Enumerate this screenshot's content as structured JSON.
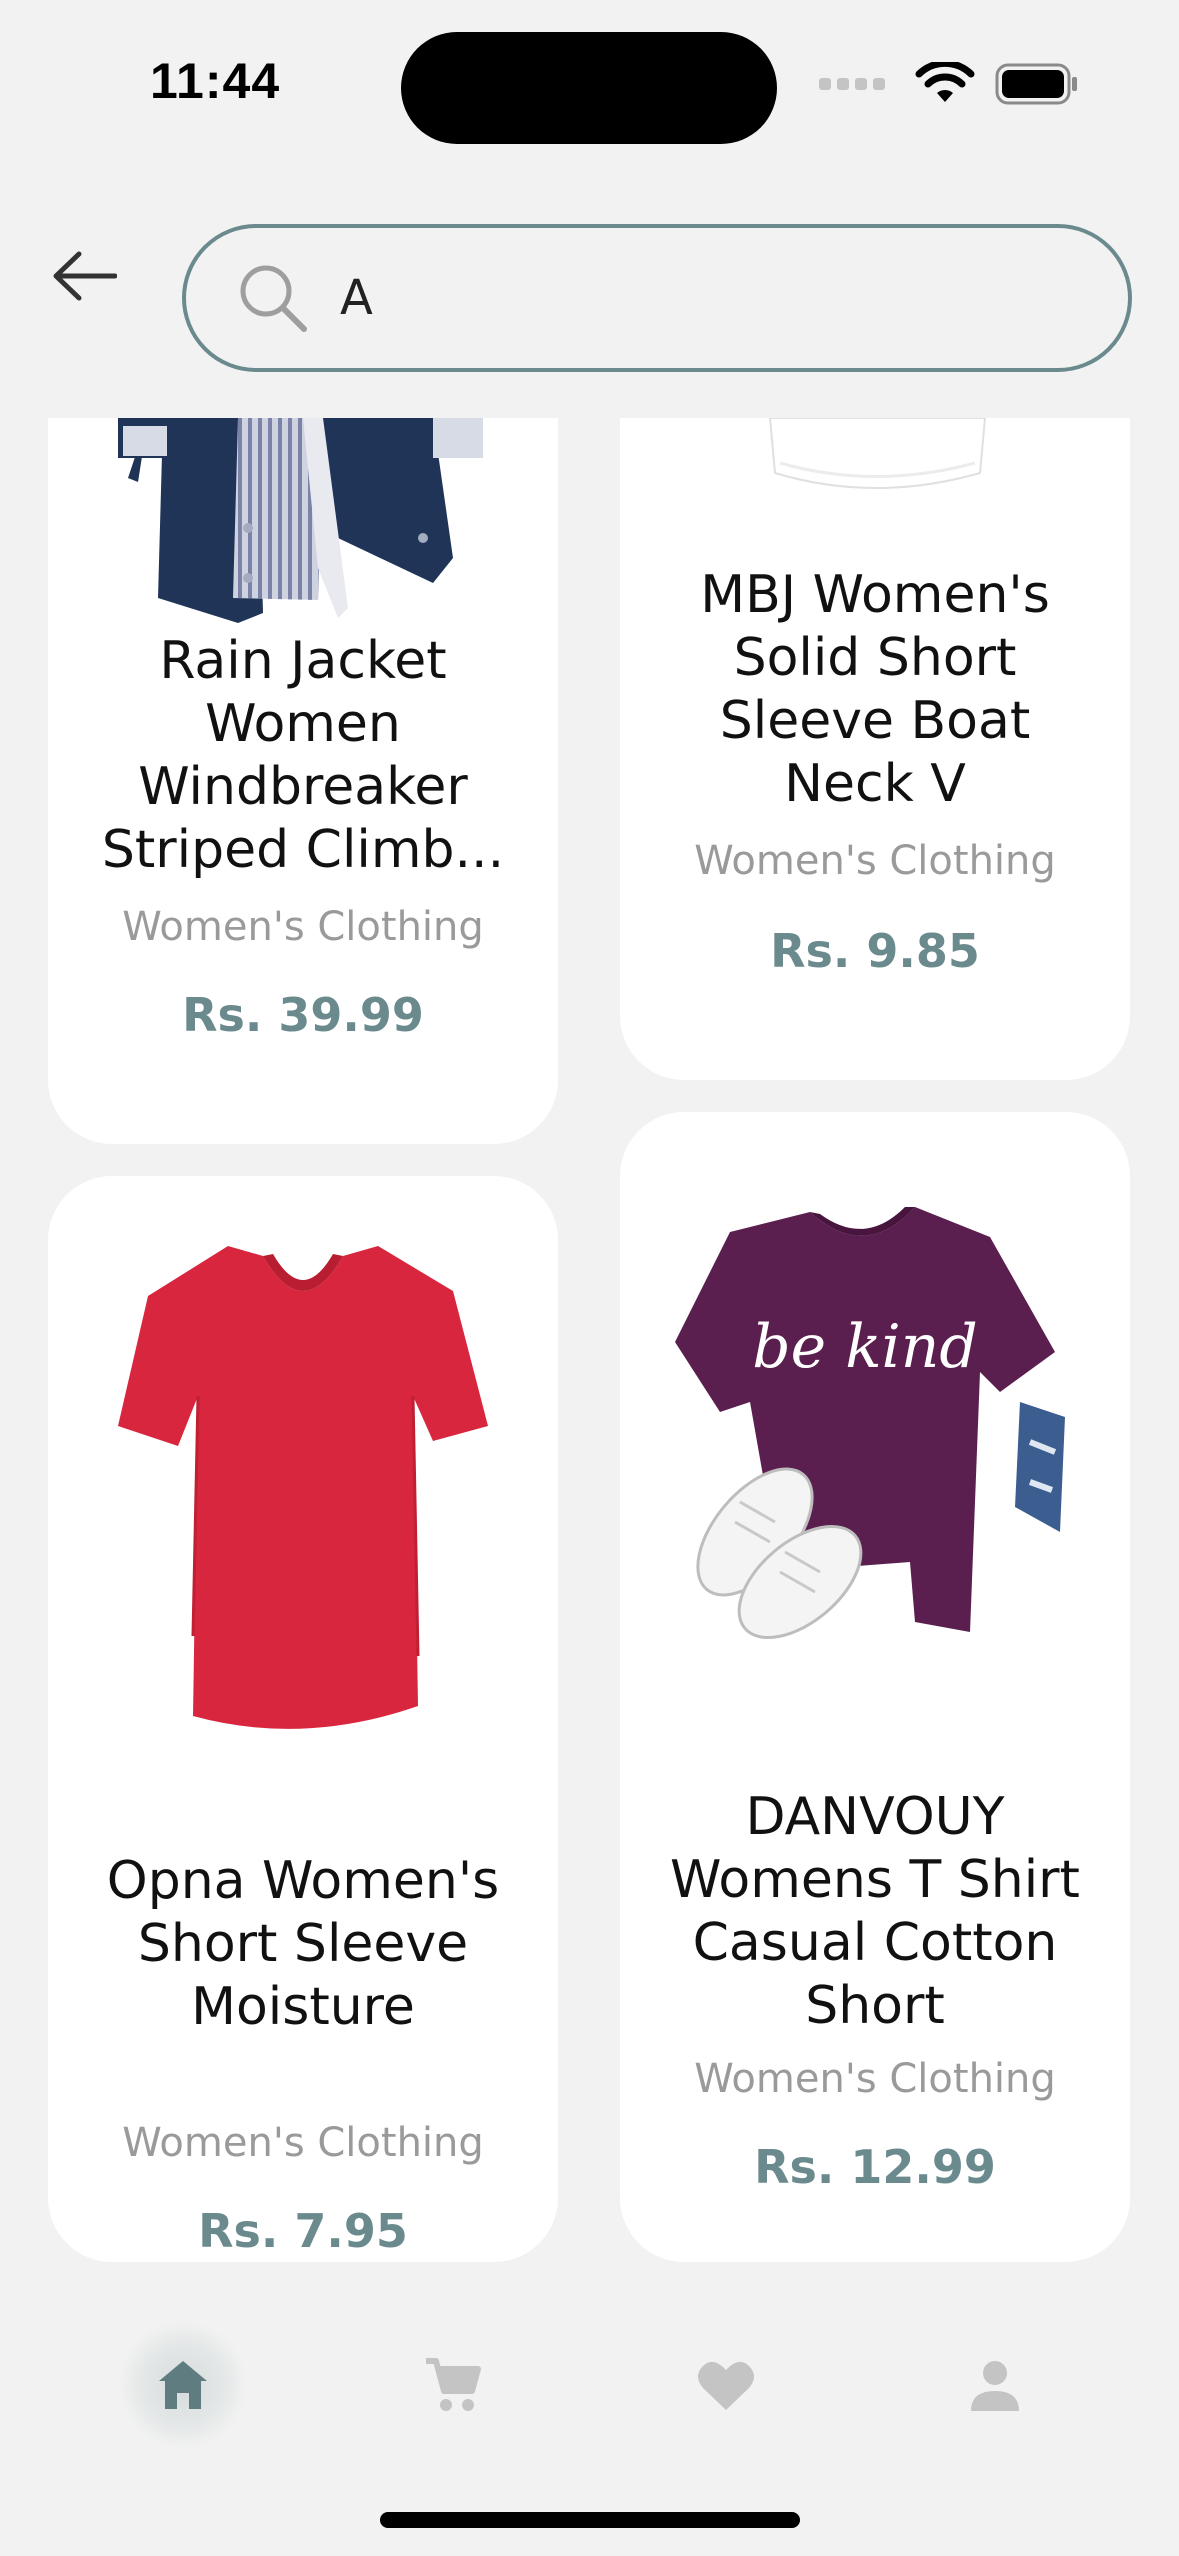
{
  "status_bar": {
    "time": "11:44"
  },
  "search": {
    "value": "A",
    "placeholder": ""
  },
  "products": [
    {
      "name": "Rain Jacket Women Windbreaker Striped Climb...",
      "category": "Women's Clothing",
      "price": "Rs. 39.99"
    },
    {
      "name": "MBJ Women's Solid Short Sleeve Boat Neck V",
      "category": "Women's Clothing",
      "price": "Rs. 9.85"
    },
    {
      "name": "Opna Women's Short Sleeve Moisture",
      "category": "Women's Clothing",
      "price": "Rs. 7.95"
    },
    {
      "name": "DANVOUY Womens T Shirt Casual Cotton Short",
      "category": "Women's Clothing",
      "price": "Rs. 12.99"
    }
  ],
  "product_art": [
    {
      "icon": "rain-jacket-image",
      "color": "#1f3457"
    },
    {
      "icon": "white-tshirt-image",
      "color": "#ffffff"
    },
    {
      "icon": "red-tshirt-image",
      "color": "#d7263d"
    },
    {
      "icon": "purple-tshirt-image",
      "color": "#5a1e4f",
      "print_text": "be kind"
    }
  ],
  "nav": [
    {
      "icon": "home-icon",
      "active": true
    },
    {
      "icon": "cart-icon",
      "active": false
    },
    {
      "icon": "heart-icon",
      "active": false
    },
    {
      "icon": "profile-icon",
      "active": false
    }
  ],
  "colors": {
    "accent": "#6b8a8d",
    "background": "#f2f2f2",
    "muted": "#c4c4c4"
  }
}
